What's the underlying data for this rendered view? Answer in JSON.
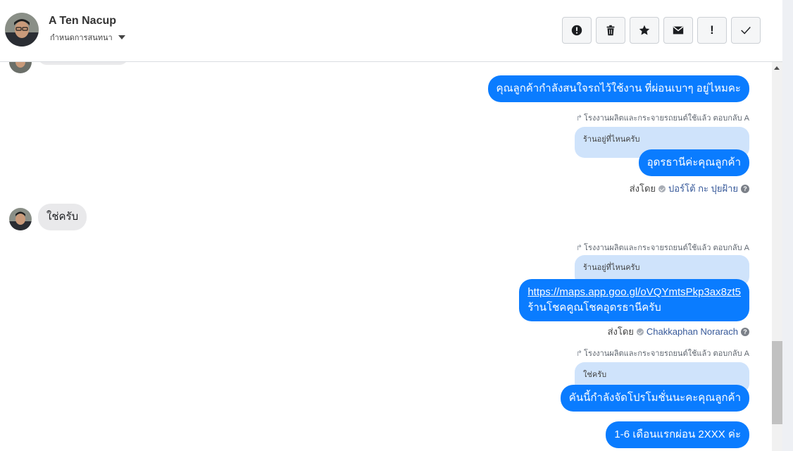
{
  "header": {
    "contact_name": "A Ten Nacup",
    "subtitle": "กำหนดการสนทนา"
  },
  "toolbar": {
    "buttons": [
      {
        "name": "report",
        "icon": "alert-circle-icon"
      },
      {
        "name": "delete",
        "icon": "trash-icon"
      },
      {
        "name": "star",
        "icon": "star-icon"
      },
      {
        "name": "mark-unread",
        "icon": "envelope-icon"
      },
      {
        "name": "important",
        "icon": "exclamation-icon",
        "label": "!"
      },
      {
        "name": "done",
        "icon": "check-icon"
      }
    ]
  },
  "messages": {
    "m1_text": "คุณลูกค้ากำลังสนใจรถไว้ใช้งาน ที่ผ่อนเบาๆ อยู่ไหมคะ",
    "r1_meta": "โรงงานผลิตและกระจายรถยนต์ใช้แล้ว ตอบกลับ A",
    "r1_quote": "ร้านอยู่ที่ไหนครับ",
    "r1_text": "อุดรธานีค่ะคุณลูกค้า",
    "r1_sender_prefix": "ส่งโดย",
    "r1_sender_name": "ปอร์โต้ กะ ปุยฝ้าย",
    "in1_text": "ใช่ครับ",
    "r2_meta": "โรงงานผลิตและกระจายรถยนต์ใช้แล้ว ตอบกลับ A",
    "r2_quote": "ร้านอยู่ที่ไหนครับ",
    "r2_link": "https://maps.app.goo.gl/oVQYmtsPkp3ax8zt5",
    "r2_text": "ร้านโชคคูณโชคอุดรธานีครับ",
    "r2_sender_prefix": "ส่งโดย",
    "r2_sender_name": "Chakkaphan Norarach",
    "r3_meta": "โรงงานผลิตและกระจายรถยนต์ใช้แล้ว ตอบกลับ A",
    "r3_quote": "ใช่ครับ",
    "r3_text": "คันนี้กำลังจัดโปรโมชั่นนะคะคุณลูกค้า",
    "m_last_text": "1-6 เดือนแรกผ่อน 2XXX ค่ะ"
  },
  "colors": {
    "outgoing_bubble": "#0a7cff",
    "incoming_bubble": "#e9e9eb",
    "quote_bubble": "#cfe3fb"
  }
}
